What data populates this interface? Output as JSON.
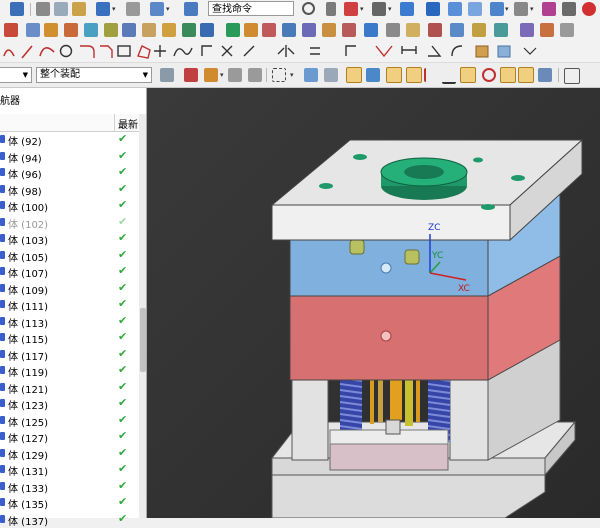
{
  "toolbar": {
    "search_text": "查找命令",
    "assembly_filter": "整个装配"
  },
  "navigator": {
    "title": "航器",
    "col_latest": "最新",
    "rows": [
      {
        "label": "体 (92)",
        "dim": false
      },
      {
        "label": "体 (94)",
        "dim": false
      },
      {
        "label": "体 (96)",
        "dim": false
      },
      {
        "label": "体 (98)",
        "dim": false
      },
      {
        "label": "体 (100)",
        "dim": false
      },
      {
        "label": "体 (102)",
        "dim": true
      },
      {
        "label": "体 (103)",
        "dim": false
      },
      {
        "label": "体 (105)",
        "dim": false
      },
      {
        "label": "体 (107)",
        "dim": false
      },
      {
        "label": "体 (109)",
        "dim": false
      },
      {
        "label": "体 (111)",
        "dim": false
      },
      {
        "label": "体 (113)",
        "dim": false
      },
      {
        "label": "体 (115)",
        "dim": false
      },
      {
        "label": "体 (117)",
        "dim": false
      },
      {
        "label": "体 (119)",
        "dim": false
      },
      {
        "label": "体 (121)",
        "dim": false
      },
      {
        "label": "体 (123)",
        "dim": false
      },
      {
        "label": "体 (125)",
        "dim": false
      },
      {
        "label": "体 (127)",
        "dim": false
      },
      {
        "label": "体 (129)",
        "dim": false
      },
      {
        "label": "体 (131)",
        "dim": false
      },
      {
        "label": "体 (133)",
        "dim": false
      },
      {
        "label": "体 (135)",
        "dim": false
      },
      {
        "label": "体 (137)",
        "dim": false
      }
    ],
    "check_glyph": "✔"
  },
  "viewport": {
    "axis_zc": "ZC",
    "axis_yc": "YC",
    "axis_xc": "XC",
    "colors": {
      "top_plate": "#e6e6e6",
      "cavity_plate": "#7fb0de",
      "core_plate": "#d77070",
      "ring": "#1e9a6a",
      "spring": "#3646a8",
      "pin": "#d99a20"
    }
  }
}
